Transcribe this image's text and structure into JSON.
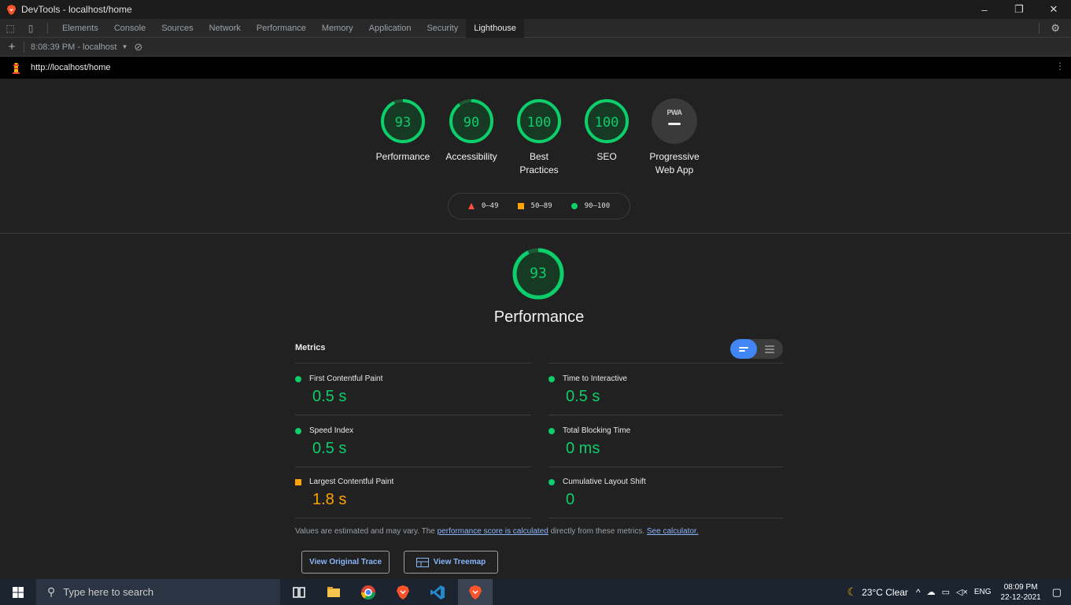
{
  "window": {
    "title": "DevTools - localhost/home"
  },
  "devtools": {
    "tabs": [
      {
        "label": "Elements"
      },
      {
        "label": "Console"
      },
      {
        "label": "Sources"
      },
      {
        "label": "Network"
      },
      {
        "label": "Performance"
      },
      {
        "label": "Memory"
      },
      {
        "label": "Application"
      },
      {
        "label": "Security"
      },
      {
        "label": "Lighthouse"
      }
    ],
    "active_tab": "Lighthouse",
    "report_selector": "8:08:39 PM - localhost",
    "url": "http://localhost/home"
  },
  "scores": [
    {
      "label": "Performance",
      "value": "93",
      "fraction": 0.93
    },
    {
      "label": "Accessibility",
      "value": "90",
      "fraction": 0.9
    },
    {
      "label": "Best Practices",
      "value": "100",
      "fraction": 1.0
    },
    {
      "label": "SEO",
      "value": "100",
      "fraction": 1.0
    }
  ],
  "pwa": {
    "badge": "PWA",
    "label": "Progressive Web App"
  },
  "legend": {
    "fail": "0–49",
    "average": "50–89",
    "pass": "90–100"
  },
  "performance": {
    "score": "93",
    "score_fraction": 0.93,
    "title": "Performance",
    "metrics_header": "Metrics",
    "metrics": [
      {
        "name": "First Contentful Paint",
        "value": "0.5 s",
        "status": "pass"
      },
      {
        "name": "Time to Interactive",
        "value": "0.5 s",
        "status": "pass"
      },
      {
        "name": "Speed Index",
        "value": "0.5 s",
        "status": "pass"
      },
      {
        "name": "Total Blocking Time",
        "value": "0 ms",
        "status": "pass"
      },
      {
        "name": "Largest Contentful Paint",
        "value": "1.8 s",
        "status": "average"
      },
      {
        "name": "Cumulative Layout Shift",
        "value": "0",
        "status": "pass"
      }
    ],
    "note": {
      "prefix": "Values are estimated and may vary. The ",
      "link1": "performance score is calculated",
      "middle": " directly from these metrics. ",
      "link2": "See calculator."
    },
    "buttons": {
      "trace": "View Original Trace",
      "treemap": "View Treemap"
    }
  },
  "taskbar": {
    "search_placeholder": "Type here to search",
    "weather": "23°C  Clear",
    "lang": "ENG",
    "time": "08:09 PM",
    "date": "22-12-2021"
  },
  "colors": {
    "pass": "#0cce6b",
    "average": "#ffa400",
    "fail": "#ff4e42",
    "accent": "#4285f4"
  }
}
